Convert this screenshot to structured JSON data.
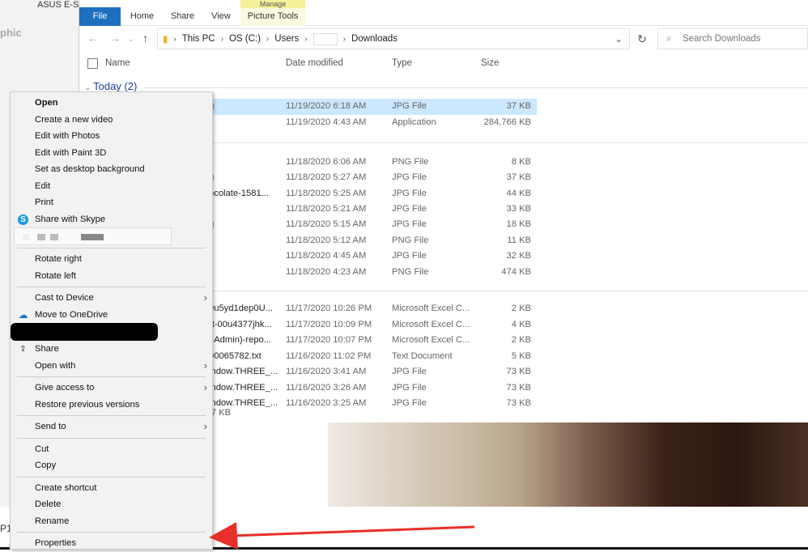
{
  "background": {
    "left_text": "phic",
    "bottom_text": "P1",
    "top_text": "ASUS E-S"
  },
  "ribbon": {
    "tabs": [
      "File",
      "Home",
      "Share",
      "View"
    ],
    "manage": "Manage",
    "picture_tools": "Picture Tools"
  },
  "address": {
    "crumbs": [
      "This PC",
      "OS (C:)",
      "Users",
      "Downloads"
    ]
  },
  "search": {
    "placeholder": "Search Downloads"
  },
  "columns": [
    "Name",
    "Date modified",
    "Type",
    "Size"
  ],
  "groups": [
    {
      "label": "Today (2)"
    }
  ],
  "rows": [
    {
      "name": "g",
      "date": "11/19/2020 6:18 AM",
      "type": "JPG File",
      "size": "37 KB"
    },
    {
      "name": "",
      "date": "11/19/2020 4:43 AM",
      "type": "Application",
      "size": "284,766 KB"
    },
    {
      "name": "",
      "date": "11/18/2020 6:06 AM",
      "type": "PNG File",
      "size": "8 KB"
    },
    {
      "name": "g",
      "date": "11/18/2020 5:27 AM",
      "type": "JPG File",
      "size": "37 KB"
    },
    {
      "name": "ocolate-1581...",
      "date": "11/18/2020 5:25 AM",
      "type": "JPG File",
      "size": "44 KB"
    },
    {
      "name": "",
      "date": "11/18/2020 5:21 AM",
      "type": "JPG File",
      "size": "33 KB"
    },
    {
      "name": "g",
      "date": "11/18/2020 5:15 AM",
      "type": "JPG File",
      "size": "18 KB"
    },
    {
      "name": "",
      "date": "11/18/2020 5:12 AM",
      "type": "PNG File",
      "size": "11 KB"
    },
    {
      "name": "",
      "date": "11/18/2020 4:45 AM",
      "type": "JPG File",
      "size": "32 KB"
    },
    {
      "name": "",
      "date": "11/18/2020 4:23 AM",
      "type": "PNG File",
      "size": "474 KB"
    },
    {
      "name": "0u5yd1dep0U...",
      "date": "11/17/2020 10:26 PM",
      "type": "Microsoft Excel C...",
      "size": "2 KB"
    },
    {
      "name": "rt-00u4377jhk...",
      "date": "11/17/2020 10:09 PM",
      "type": "Microsoft Excel C...",
      "size": "4 KB"
    },
    {
      "name": "l-Admin)-repo...",
      "date": "11/17/2020 10:07 PM",
      "type": "Microsoft Excel C...",
      "size": "2 KB"
    },
    {
      "name": "00065782.txt",
      "date": "11/16/2020 11:02 PM",
      "type": "Text Document",
      "size": "5 KB"
    },
    {
      "name": "indow.THREE_...",
      "date": "11/16/2020 3:41 AM",
      "type": "JPG File",
      "size": "73 KB"
    },
    {
      "name": "indow.THREE_...",
      "date": "11/16/2020 3:26 AM",
      "type": "JPG File",
      "size": "73 KB"
    },
    {
      "name": "indow.THREE_...",
      "date": "11/16/2020 3:25 AM",
      "type": "JPG File",
      "size": "73 KB"
    }
  ],
  "status": ".7 KB",
  "menu": {
    "open": "Open",
    "create_video": "Create a new video",
    "edit_photos": "Edit with Photos",
    "edit_paint3d": "Edit with Paint 3D",
    "set_bg": "Set as desktop background",
    "edit": "Edit",
    "print": "Print",
    "share_skype": "Share with Skype",
    "rotate_right": "Rotate right",
    "rotate_left": "Rotate left",
    "cast": "Cast to Device",
    "onedrive": "Move to OneDrive",
    "share": "Share",
    "open_with": "Open with",
    "give_access": "Give access to",
    "restore": "Restore previous versions",
    "send_to": "Send to",
    "cut": "Cut",
    "copy": "Copy",
    "create_shortcut": "Create shortcut",
    "delete": "Delete",
    "rename": "Rename",
    "properties": "Properties"
  },
  "colors": {
    "accent": "#1f6fbf",
    "selection": "#cce8ff",
    "arrow": "#e8302a"
  }
}
